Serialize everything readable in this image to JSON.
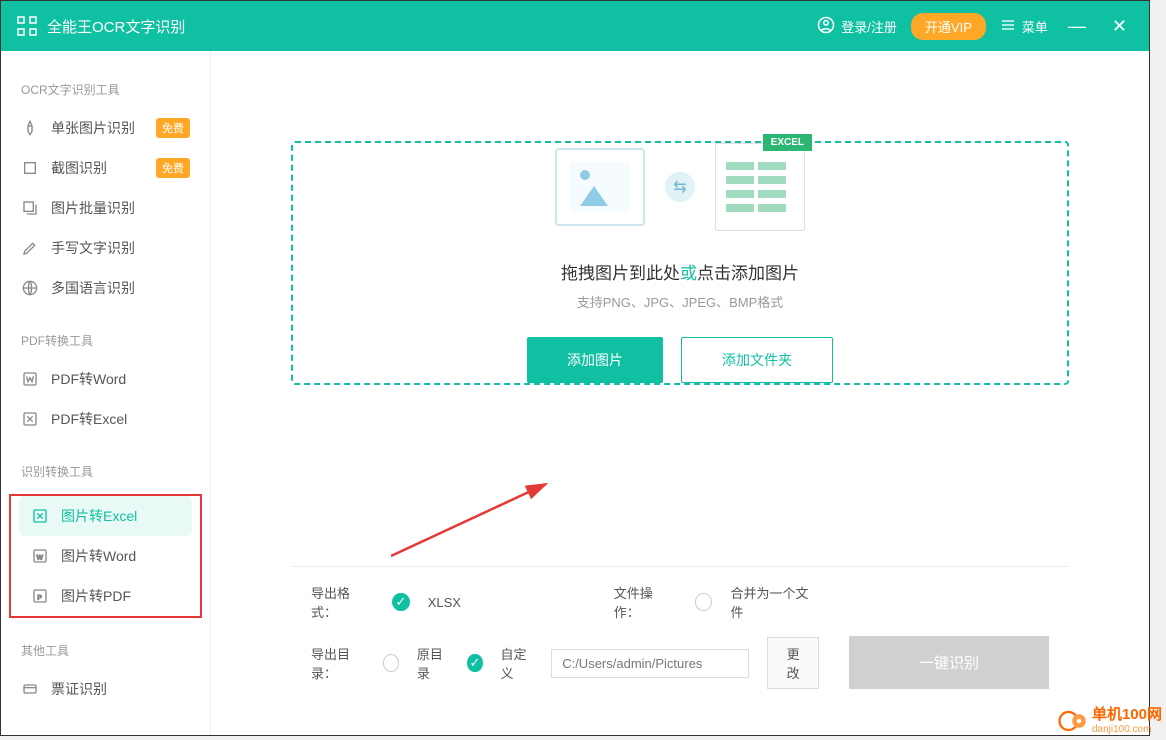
{
  "titlebar": {
    "app_title": "全能王OCR文字识别",
    "login_label": "登录/注册",
    "vip_label": "开通VIP",
    "menu_label": "菜单"
  },
  "sidebar": {
    "section1_title": "OCR文字识别工具",
    "section1_items": [
      {
        "label": "单张图片识别",
        "free": "免费"
      },
      {
        "label": "截图识别",
        "free": "免费"
      },
      {
        "label": "图片批量识别"
      },
      {
        "label": "手写文字识别"
      },
      {
        "label": "多国语言识别"
      }
    ],
    "section2_title": "PDF转换工具",
    "section2_items": [
      {
        "label": "PDF转Word"
      },
      {
        "label": "PDF转Excel"
      }
    ],
    "section3_title": "识别转换工具",
    "section3_items": [
      {
        "label": "图片转Excel"
      },
      {
        "label": "图片转Word"
      },
      {
        "label": "图片转PDF"
      }
    ],
    "section4_title": "其他工具",
    "section4_items": [
      {
        "label": "票证识别"
      }
    ]
  },
  "dropzone": {
    "excel_tag": "EXCEL",
    "drag_text_pre": "拖拽图片到此处",
    "drag_text_or": "或",
    "drag_text_post": "点击添加图片",
    "supported": "支持PNG、JPG、JPEG、BMP格式",
    "add_image_btn": "添加图片",
    "add_folder_btn": "添加文件夹"
  },
  "bottombar": {
    "output_format_label": "导出格式：",
    "format_value": "XLSX",
    "file_op_label": "文件操作：",
    "file_op_value": "合并为一个文件",
    "output_dir_label": "导出目录：",
    "dir_original": "原目录",
    "dir_custom": "自定义",
    "path_value": "C:/Users/admin/Pictures",
    "modify_label": "更改",
    "recognize_label": "一键识别"
  },
  "watermark": {
    "main": "单机100网",
    "sub": "danji100.com"
  }
}
